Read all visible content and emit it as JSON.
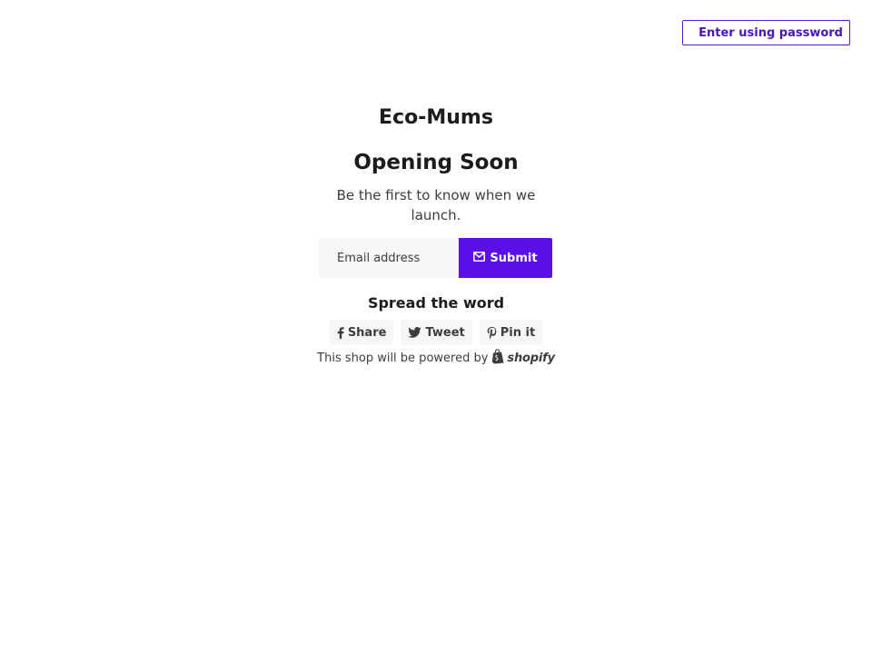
{
  "header": {
    "password_button_label": "Enter using password"
  },
  "main": {
    "store_name": "Eco-Mums",
    "headline": "Opening Soon",
    "subtext": "Be the first to know when we launch."
  },
  "signup": {
    "email_placeholder": "Email address",
    "email_value": "",
    "submit_label": "Submit",
    "submit_icon": "envelope-icon"
  },
  "share": {
    "heading": "Spread the word",
    "buttons": [
      {
        "label": "Share",
        "icon": "facebook-icon"
      },
      {
        "label": "Tweet",
        "icon": "twitter-icon"
      },
      {
        "label": "Pin it",
        "icon": "pinterest-icon"
      }
    ]
  },
  "footer": {
    "powered_text": "This shop will be powered by",
    "brand": "shopify"
  },
  "colors": {
    "accent": "#5b0ee8",
    "text": "#1c1c1c",
    "muted_bg": "#f6f6f6"
  }
}
